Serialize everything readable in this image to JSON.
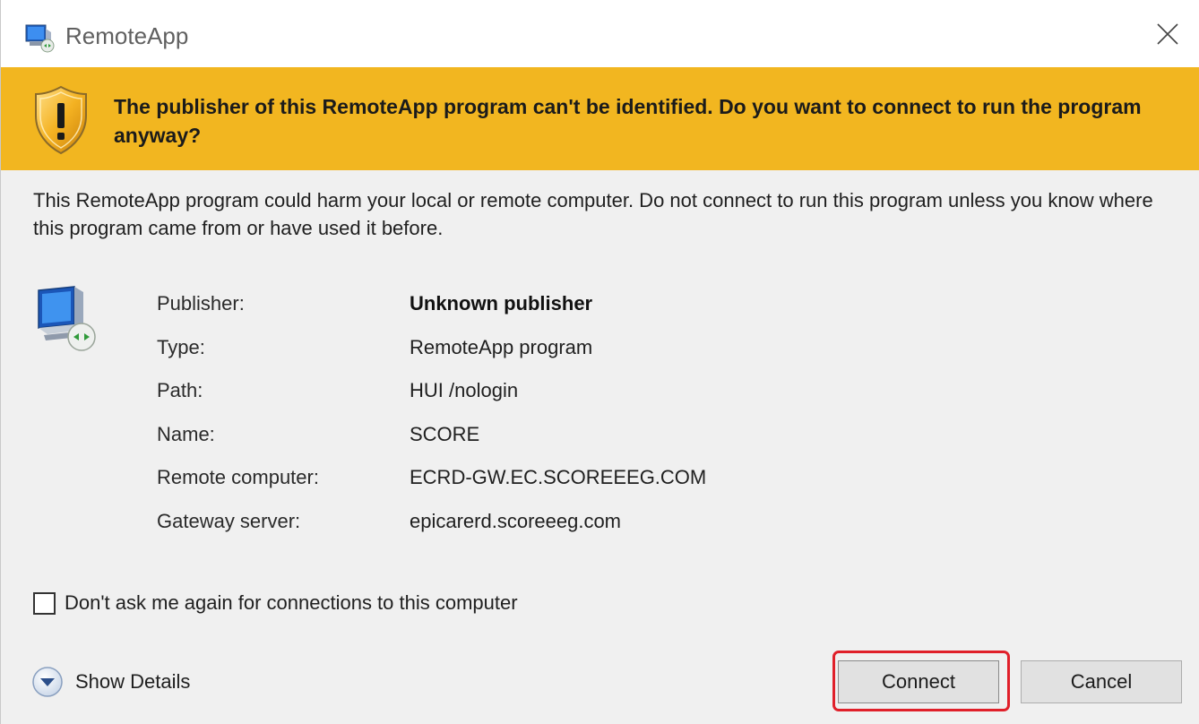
{
  "window": {
    "title": "RemoteApp",
    "close_icon": "close-icon"
  },
  "banner": {
    "icon": "warning-shield-icon",
    "background": "#f2b620",
    "message": "The publisher of this RemoteApp program can't be identified. Do you want to connect to run the program anyway?"
  },
  "warning": {
    "text": "This RemoteApp program could harm your local or remote computer. Do not connect to run this program unless you know where this program came from or have used it before."
  },
  "info": {
    "icon": "remote-computer-icon",
    "rows": [
      {
        "label": "Publisher:",
        "value": "Unknown publisher"
      },
      {
        "label": "Type:",
        "value": "RemoteApp program"
      },
      {
        "label": "Path:",
        "value": "HUI /nologin"
      },
      {
        "label": "Name:",
        "value": "SCORE"
      },
      {
        "label": "Remote computer:",
        "value": "ECRD-GW.EC.SCOREEEG.COM"
      },
      {
        "label": "Gateway server:",
        "value": "epicarerd.scoreeeg.com"
      }
    ]
  },
  "checkbox": {
    "label": "Don't ask me again for connections to this computer",
    "checked": false
  },
  "details": {
    "label": "Show Details",
    "icon": "chevron-down-circle-icon"
  },
  "buttons": {
    "connect": "Connect",
    "cancel": "Cancel",
    "highlight_color": "#e0202a"
  }
}
